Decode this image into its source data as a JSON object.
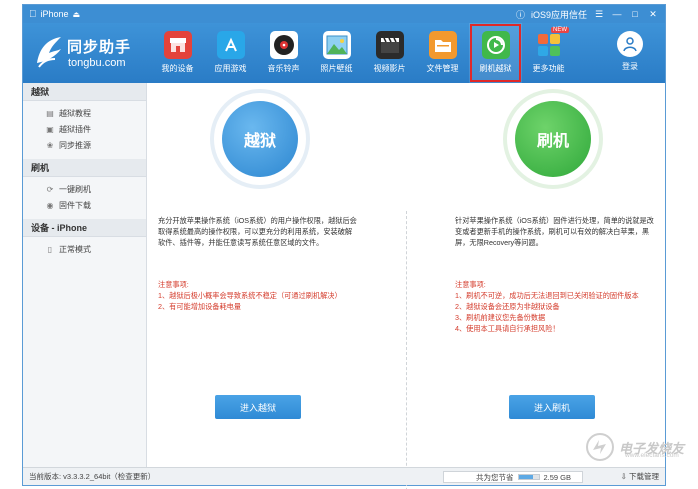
{
  "titlebar": {
    "device": "iPhone",
    "trust_label": "iOS9应用信任"
  },
  "logo": {
    "name": "同步助手",
    "domain": "tongbu.com"
  },
  "toolbar": [
    {
      "label": "我的设备",
      "icon": "store-icon",
      "color": "#e4433b"
    },
    {
      "label": "应用游戏",
      "icon": "appstore-icon",
      "color": "#29a7e8"
    },
    {
      "label": "音乐铃声",
      "icon": "music-disc-icon",
      "color": "#333333"
    },
    {
      "label": "照片壁纸",
      "icon": "photo-icon",
      "color": "#4fb35a"
    },
    {
      "label": "视频影片",
      "icon": "clapper-icon",
      "color": "#2b2b2b"
    },
    {
      "label": "文件管理",
      "icon": "folder-icon",
      "color": "#f2992e"
    },
    {
      "label": "刷机越狱",
      "icon": "flash-icon",
      "color": "#40b84a"
    },
    {
      "label": "更多功能",
      "icon": "more-apps-icon",
      "color": "#f16a3a",
      "badge": "NEW"
    }
  ],
  "login_label": "登录",
  "sidebar": {
    "sections": [
      {
        "title": "越狱",
        "items": [
          {
            "label": "越狱教程",
            "icon": "book-icon"
          },
          {
            "label": "越狱插件",
            "icon": "plugin-icon"
          },
          {
            "label": "同步推源",
            "icon": "source-icon"
          }
        ]
      },
      {
        "title": "刷机",
        "items": [
          {
            "label": "一键刷机",
            "icon": "flash-small-icon"
          },
          {
            "label": "固件下载",
            "icon": "firmware-icon"
          }
        ]
      },
      {
        "title": "设备 - iPhone",
        "items": [
          {
            "label": "正常模式",
            "icon": "phone-mode-icon"
          }
        ]
      }
    ]
  },
  "jailbreak": {
    "circle_label": "越狱",
    "description": "充分开放苹果操作系统（iOS系统）的用户操作权限，越狱后会取得系统最高的操作权限，可以更充分的利用系统，安装破解软件、插件等，并能任意读写系统任意区域的文件。",
    "notes_title": "注意事项:",
    "notes": [
      "1、越狱后极小概率会导致系统不稳定（可通过刷机解决）",
      "2、有可能增加设备耗电量"
    ],
    "button_label": "进入越狱"
  },
  "flash": {
    "circle_label": "刷机",
    "description": "针对苹果操作系统（iOS系统）固件进行处理，简单的说就是改变或者更新手机的操作系统，刷机可以有效的解决白苹果，黑屏，无限Recovery等问题。",
    "notes_title": "注意事项:",
    "notes": [
      "1、刷机不可逆，成功后无法退回到已关闭验证的固件版本",
      "2、越狱设备会还原为非越狱设备",
      "3、刷机前建议您先备份数据",
      "4、使用本工具请自行承担风险！"
    ],
    "button_label": "进入刷机"
  },
  "status": {
    "version": "当前版本: v3.3.3.2_64bit（检查更新）",
    "space_label": "共为您节省",
    "space_value": "2.59 GB",
    "space_percent": 70,
    "download_label": "下载管理"
  },
  "watermark": {
    "text": "电子发烧友",
    "sub": "www.elecfans.com"
  }
}
